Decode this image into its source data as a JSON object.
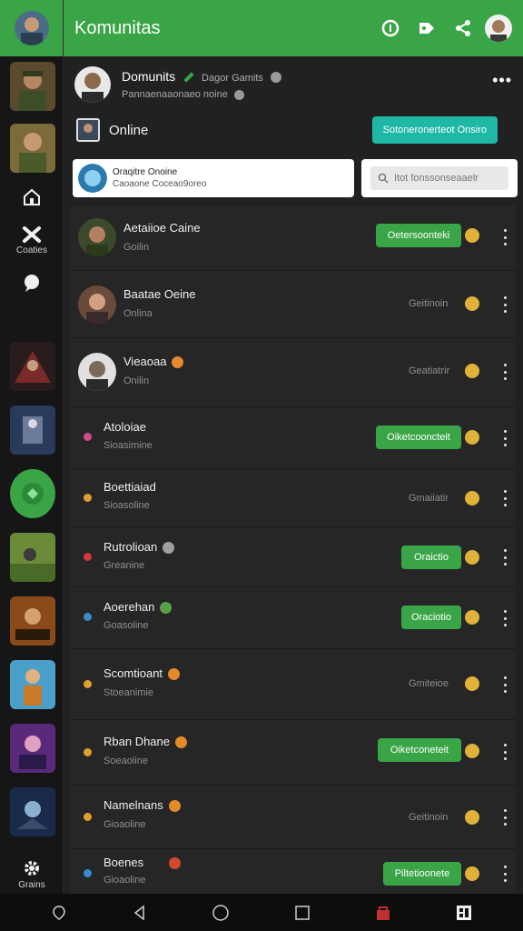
{
  "header": {
    "title": "Komunitas"
  },
  "rail": {
    "label_1": "Coaties",
    "label_2": "Grains"
  },
  "group": {
    "name": "Domunits",
    "tag": "Dagor Gamits",
    "subtitle": "Pannaenaaonaeo noine"
  },
  "online": {
    "label": "Online",
    "button": "Sotoneronerteot Onsiro"
  },
  "profile_card": {
    "line1": "Oraqitre Onoine",
    "line2": "Caoaone Coceao9oreo"
  },
  "search": {
    "placeholder": "Itot fonssonseaaelr"
  },
  "list": [
    {
      "name": "Aetaiioe Caine",
      "sub": "Goilin",
      "action": "Oetersoonteki"
    },
    {
      "name": "Baatae Oeine",
      "sub": "Onlina",
      "action": "Geitinoin"
    },
    {
      "name": "Vieaoaa",
      "sub": "Onilin",
      "action": "Geatiatrir"
    },
    {
      "name": "Atoloiae",
      "sub": "Sioasimine",
      "action": "Oiketcooncteit"
    },
    {
      "name": "Boettiaiad",
      "sub": "Sioasoline",
      "action": "Gmaiiatir"
    },
    {
      "name": "Rutrolioan",
      "sub": "Greanine",
      "action": "Oraictio"
    },
    {
      "name": "Aoerehan",
      "sub": "Goasoline",
      "action": "Oraciotio"
    },
    {
      "name": "Scomtioant",
      "sub": "Stoeanimie",
      "action": "Gmiteioe"
    },
    {
      "name": "Rban Dhane",
      "sub": "Soeaoline",
      "action": "Oiketconeteit"
    },
    {
      "name": "Namelnans",
      "sub": "Gioaoline",
      "action": "Geitinoin"
    },
    {
      "name": "Boenes",
      "sub": "Gioaoline",
      "action": "Piltetioonete"
    }
  ],
  "colors": {
    "brand": "#3aa546",
    "teal": "#1fb8a6"
  }
}
